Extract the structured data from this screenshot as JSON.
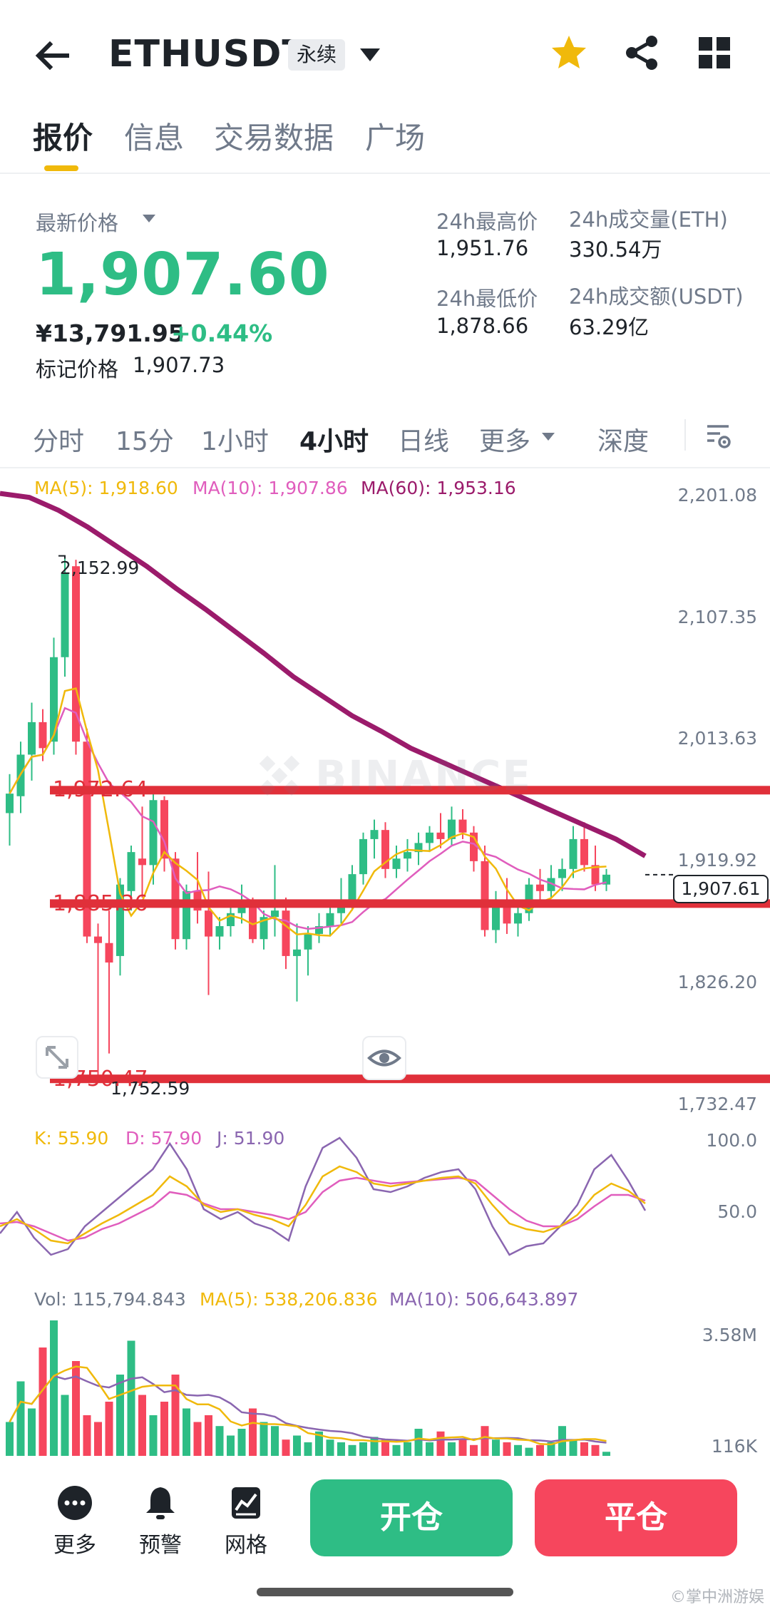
{
  "header": {
    "symbol": "ETHUSDT",
    "badge": "永续",
    "icons": [
      "back-arrow-icon",
      "chevron-down-icon",
      "star-icon",
      "share-icon",
      "grid-icon"
    ]
  },
  "tabs": [
    "报价",
    "信息",
    "交易数据",
    "广场"
  ],
  "price": {
    "label": "最新价格",
    "last": "1,907.60",
    "cny": "¥13,791.95",
    "change": "+0.44%",
    "mark_label": "标记价格",
    "mark_value": "1,907.73"
  },
  "stats": {
    "high_label": "24h最高价",
    "high_value": "1,951.76",
    "low_label": "24h最低价",
    "low_value": "1,878.66",
    "vol_eth_label": "24h成交量(ETH)",
    "vol_eth_value": "330.54万",
    "vol_usdt_label": "24h成交额(USDT)",
    "vol_usdt_value": "63.29亿"
  },
  "intervals": [
    "分时",
    "15分",
    "1小时",
    "4小时",
    "日线",
    "更多",
    "深度"
  ],
  "ma_legend": {
    "ma5": "MA(5): 1,918.60",
    "ma10": "MA(10): 1,907.86",
    "ma60": "MA(60): 1,953.16"
  },
  "price_axis": [
    "2,201.08",
    "2,107.35",
    "2,013.63",
    "1,919.92",
    "1,826.20",
    "1,732.47"
  ],
  "current_price_tag": "1,907.61",
  "chart_annotations": {
    "high": "2,152.99",
    "low": "1,752.59",
    "line_a": "1,972.64",
    "line_b": "1,885.36",
    "line_c": "1,750.47"
  },
  "watermark": "BINANCE",
  "kdj": {
    "k": "K: 55.90",
    "d": "D: 57.90",
    "j": "J: 51.90",
    "axis": [
      "100.0",
      "50.0"
    ]
  },
  "volume": {
    "vol": "Vol: 115,794.843",
    "ma5": "MA(5): 538,206.836",
    "ma10": "MA(10): 506,643.897",
    "axis": [
      "3.58M",
      "116K"
    ]
  },
  "bottom": {
    "more": "更多",
    "alert": "预警",
    "grid": "网格",
    "open": "开仓",
    "close": "平仓"
  },
  "corner_watermark": "©掌中洲游娱",
  "colors": {
    "up": "#2ebd85",
    "down": "#f6465d",
    "ma5": "#f0b90b",
    "ma10": "#e05dbd",
    "ma60": "#9b1b6b",
    "accent": "#f0b90b"
  },
  "chart_data": {
    "type": "candlestick",
    "timeframe": "4小时",
    "candles": [
      {
        "o": 1955,
        "h": 1985,
        "l": 1930,
        "c": 1970
      },
      {
        "o": 1968,
        "h": 2010,
        "l": 1955,
        "c": 2000
      },
      {
        "o": 2000,
        "h": 2040,
        "l": 1980,
        "c": 2025
      },
      {
        "o": 2025,
        "h": 2035,
        "l": 1995,
        "c": 2005
      },
      {
        "o": 2010,
        "h": 2090,
        "l": 2000,
        "c": 2075
      },
      {
        "o": 2075,
        "h": 2152.99,
        "l": 2060,
        "c": 2140
      },
      {
        "o": 2145,
        "h": 2150,
        "l": 2000,
        "c": 2010
      },
      {
        "o": 2010,
        "h": 2020,
        "l": 1855,
        "c": 1860
      },
      {
        "o": 1860,
        "h": 1870,
        "l": 1752.59,
        "c": 1855
      },
      {
        "o": 1855,
        "h": 1880,
        "l": 1770,
        "c": 1840
      },
      {
        "o": 1845,
        "h": 1905,
        "l": 1830,
        "c": 1900
      },
      {
        "o": 1895,
        "h": 1930,
        "l": 1880,
        "c": 1925
      },
      {
        "o": 1920,
        "h": 1960,
        "l": 1890,
        "c": 1915
      },
      {
        "o": 1915,
        "h": 1975,
        "l": 1900,
        "c": 1965
      },
      {
        "o": 1965,
        "h": 1968,
        "l": 1910,
        "c": 1920
      },
      {
        "o": 1920,
        "h": 1925,
        "l": 1850,
        "c": 1858
      },
      {
        "o": 1858,
        "h": 1900,
        "l": 1850,
        "c": 1895
      },
      {
        "o": 1895,
        "h": 1925,
        "l": 1870,
        "c": 1880
      },
      {
        "o": 1880,
        "h": 1910,
        "l": 1815,
        "c": 1860
      },
      {
        "o": 1860,
        "h": 1875,
        "l": 1850,
        "c": 1868
      },
      {
        "o": 1868,
        "h": 1885,
        "l": 1860,
        "c": 1878
      },
      {
        "o": 1878,
        "h": 1900,
        "l": 1870,
        "c": 1883
      },
      {
        "o": 1883,
        "h": 1890,
        "l": 1855,
        "c": 1858
      },
      {
        "o": 1858,
        "h": 1880,
        "l": 1850,
        "c": 1875
      },
      {
        "o": 1875,
        "h": 1915,
        "l": 1860,
        "c": 1880
      },
      {
        "o": 1880,
        "h": 1890,
        "l": 1835,
        "c": 1845
      },
      {
        "o": 1845,
        "h": 1870,
        "l": 1810,
        "c": 1850
      },
      {
        "o": 1850,
        "h": 1868,
        "l": 1830,
        "c": 1862
      },
      {
        "o": 1862,
        "h": 1878,
        "l": 1855,
        "c": 1868
      },
      {
        "o": 1868,
        "h": 1885,
        "l": 1860,
        "c": 1878
      },
      {
        "o": 1878,
        "h": 1905,
        "l": 1870,
        "c": 1888
      },
      {
        "o": 1888,
        "h": 1915,
        "l": 1880,
        "c": 1908
      },
      {
        "o": 1908,
        "h": 1940,
        "l": 1900,
        "c": 1935
      },
      {
        "o": 1935,
        "h": 1950,
        "l": 1920,
        "c": 1942
      },
      {
        "o": 1942,
        "h": 1948,
        "l": 1905,
        "c": 1912
      },
      {
        "o": 1912,
        "h": 1930,
        "l": 1905,
        "c": 1920
      },
      {
        "o": 1920,
        "h": 1935,
        "l": 1910,
        "c": 1925
      },
      {
        "o": 1925,
        "h": 1940,
        "l": 1915,
        "c": 1932
      },
      {
        "o": 1932,
        "h": 1945,
        "l": 1925,
        "c": 1940
      },
      {
        "o": 1940,
        "h": 1955,
        "l": 1928,
        "c": 1935
      },
      {
        "o": 1935,
        "h": 1960,
        "l": 1930,
        "c": 1950
      },
      {
        "o": 1950,
        "h": 1958,
        "l": 1935,
        "c": 1940
      },
      {
        "o": 1940,
        "h": 1945,
        "l": 1910,
        "c": 1918
      },
      {
        "o": 1918,
        "h": 1930,
        "l": 1860,
        "c": 1865
      },
      {
        "o": 1865,
        "h": 1895,
        "l": 1855,
        "c": 1888
      },
      {
        "o": 1888,
        "h": 1905,
        "l": 1862,
        "c": 1870
      },
      {
        "o": 1870,
        "h": 1885,
        "l": 1860,
        "c": 1878
      },
      {
        "o": 1878,
        "h": 1905,
        "l": 1872,
        "c": 1900
      },
      {
        "o": 1900,
        "h": 1912,
        "l": 1885,
        "c": 1895
      },
      {
        "o": 1895,
        "h": 1915,
        "l": 1890,
        "c": 1905
      },
      {
        "o": 1905,
        "h": 1920,
        "l": 1895,
        "c": 1912
      },
      {
        "o": 1912,
        "h": 1945,
        "l": 1905,
        "c": 1935
      },
      {
        "o": 1935,
        "h": 1948,
        "l": 1910,
        "c": 1915
      },
      {
        "o": 1915,
        "h": 1930,
        "l": 1895,
        "c": 1900
      },
      {
        "o": 1900,
        "h": 1912,
        "l": 1895,
        "c": 1907.6
      }
    ],
    "ma60": [
      2201,
      2198,
      2188,
      2175,
      2160,
      2145,
      2128,
      2112,
      2095,
      2078,
      2060,
      2045,
      2030,
      2018,
      2005,
      1995,
      1985,
      1975,
      1965,
      1955,
      1945,
      1935,
      1922
    ],
    "kdj_k": [
      40,
      45,
      38,
      30,
      28,
      35,
      42,
      48,
      55,
      62,
      75,
      68,
      55,
      50,
      52,
      48,
      45,
      40,
      55,
      75,
      82,
      78,
      70,
      68,
      70,
      72,
      74,
      75,
      70,
      55,
      42,
      38,
      36,
      40,
      48,
      62,
      70,
      65,
      56
    ],
    "kdj_d": [
      42,
      43,
      40,
      35,
      30,
      32,
      38,
      42,
      48,
      54,
      64,
      62,
      56,
      52,
      52,
      50,
      48,
      45,
      50,
      64,
      72,
      74,
      72,
      70,
      71,
      72,
      73,
      74,
      72,
      62,
      52,
      44,
      40,
      40,
      45,
      54,
      62,
      62,
      58
    ],
    "kdj_j": [
      35,
      50,
      32,
      20,
      24,
      40,
      50,
      60,
      70,
      80,
      98,
      80,
      52,
      45,
      50,
      42,
      38,
      30,
      68,
      95,
      102,
      88,
      66,
      64,
      68,
      74,
      78,
      80,
      66,
      40,
      20,
      26,
      28,
      40,
      55,
      80,
      90,
      72,
      51
    ],
    "volumes": [
      0.25,
      0.55,
      0.35,
      0.8,
      1.0,
      0.45,
      0.7,
      0.3,
      0.25,
      0.4,
      0.6,
      0.85,
      0.45,
      0.3,
      0.4,
      0.6,
      0.35,
      0.25,
      0.3,
      0.22,
      0.15,
      0.2,
      0.35,
      0.25,
      0.22,
      0.12,
      0.15,
      0.1,
      0.18,
      0.12,
      0.1,
      0.08,
      0.1,
      0.14,
      0.12,
      0.08,
      0.1,
      0.2,
      0.1,
      0.18,
      0.1,
      0.12,
      0.08,
      0.22,
      0.12,
      0.1,
      0.08,
      0.06,
      0.08,
      0.1,
      0.22,
      0.12,
      0.1,
      0.08,
      0.03
    ]
  }
}
